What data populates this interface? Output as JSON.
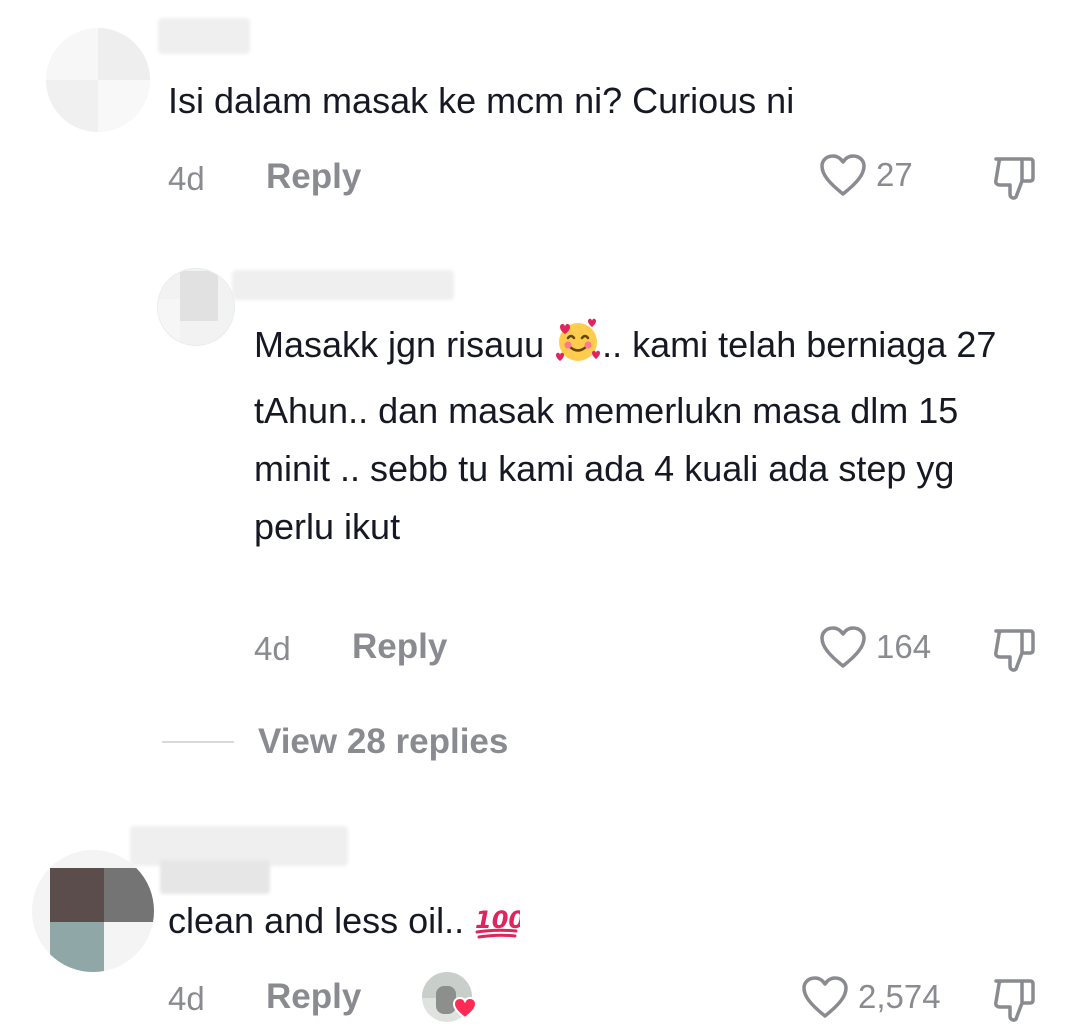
{
  "comments": [
    {
      "text": "Isi dalam masak ke mcm ni? Curious ni",
      "time": "4d",
      "reply_label": "Reply",
      "likes": "27"
    },
    {
      "text_before_emoji": "Masakk jgn risauu ",
      "emoji": "smiling-face-with-hearts",
      "text_after_emoji": ".. kami telah berniaga 27 tAhun.. dan masak memerlukn masa dlm 15 minit .. sebb tu kami ada 4 kuali ada step yg perlu ikut",
      "time": "4d",
      "reply_label": "Reply",
      "likes": "164"
    },
    {
      "text": "clean and less oil.. ",
      "emoji": "hundred-points",
      "time": "4d",
      "reply_label": "Reply",
      "likes": "2,574"
    }
  ],
  "view_replies": {
    "label": "View 28 replies"
  },
  "colors": {
    "text": "#161823",
    "muted": "#8a8b91",
    "heart_badge": "#fe2c55"
  }
}
